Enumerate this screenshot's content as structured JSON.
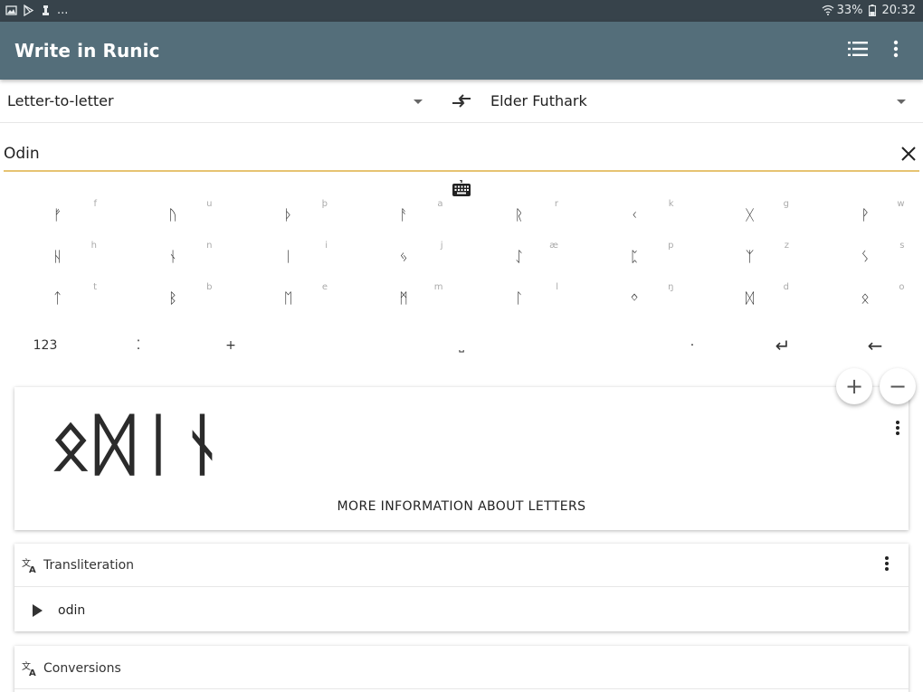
{
  "statusbar": {
    "left_icons": [
      "image-icon",
      "play-store-icon",
      "chess-icon"
    ],
    "more": "...",
    "battery": "33%",
    "time": "20:32"
  },
  "appbar": {
    "title": "Write in Runic",
    "actions": [
      "list-icon",
      "more-vert-icon"
    ]
  },
  "selectors": {
    "mode": "Letter-to-letter",
    "alphabet": "Elder Futhark"
  },
  "input": {
    "value": "Odin",
    "placeholder": ""
  },
  "keyboard": {
    "rows": [
      [
        {
          "rune": "ᚠ",
          "hint": "f"
        },
        {
          "rune": "ᚢ",
          "hint": "u"
        },
        {
          "rune": "ᚦ",
          "hint": "þ"
        },
        {
          "rune": "ᚨ",
          "hint": "a"
        },
        {
          "rune": "ᚱ",
          "hint": "r"
        },
        {
          "rune": "ᚲ",
          "hint": "k"
        },
        {
          "rune": "ᚷ",
          "hint": "g"
        },
        {
          "rune": "ᚹ",
          "hint": "w"
        }
      ],
      [
        {
          "rune": "ᚺ",
          "hint": "h"
        },
        {
          "rune": "ᚾ",
          "hint": "n"
        },
        {
          "rune": "ᛁ",
          "hint": "i"
        },
        {
          "rune": "ᛃ",
          "hint": "j"
        },
        {
          "rune": "ᛇ",
          "hint": "æ"
        },
        {
          "rune": "ᛈ",
          "hint": "p"
        },
        {
          "rune": "ᛉ",
          "hint": "z"
        },
        {
          "rune": "ᛊ",
          "hint": "s"
        }
      ],
      [
        {
          "rune": "ᛏ",
          "hint": "t"
        },
        {
          "rune": "ᛒ",
          "hint": "b"
        },
        {
          "rune": "ᛖ",
          "hint": "e"
        },
        {
          "rune": "ᛗ",
          "hint": "m"
        },
        {
          "rune": "ᛚ",
          "hint": "l"
        },
        {
          "rune": "ᛜ",
          "hint": "ŋ"
        },
        {
          "rune": "ᛞ",
          "hint": "d"
        },
        {
          "rune": "ᛟ",
          "hint": "o"
        }
      ]
    ],
    "bottom": {
      "numbers": "123",
      "colon": "⁚",
      "cross": "+",
      "space": "⎵",
      "dot": "·",
      "enter": "↵",
      "backspace": "←"
    }
  },
  "zoom": {
    "plus": "+",
    "minus": "−"
  },
  "output": {
    "runes": "ᛟᛞᛁᚾ",
    "more_info": "MORE INFORMATION ABOUT LETTERS"
  },
  "transliteration": {
    "title": "Transliteration",
    "text": "odin"
  },
  "conversions": {
    "title": "Conversions"
  }
}
